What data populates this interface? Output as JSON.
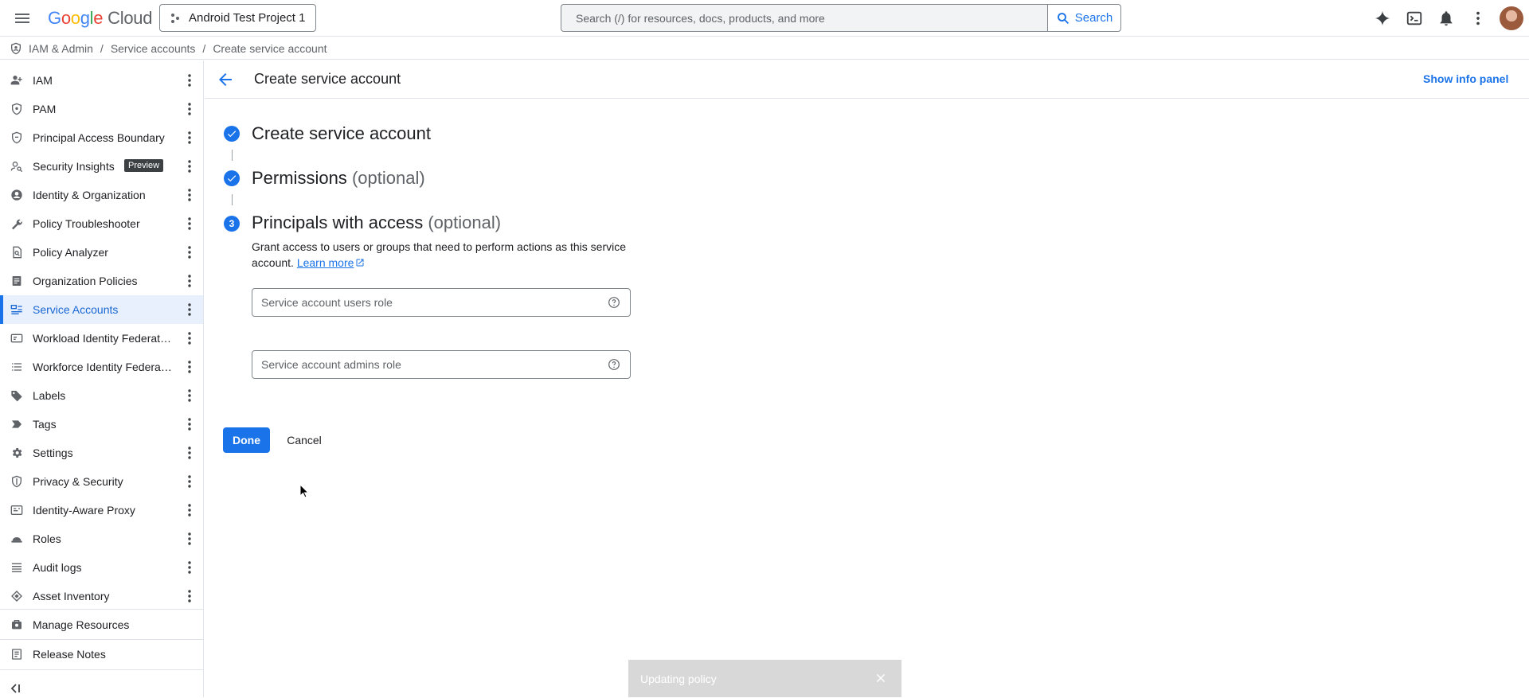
{
  "topbar": {
    "logo_google": "Google",
    "logo_cloud": "Cloud",
    "project_name": "Android Test Project 1",
    "search_placeholder": "Search (/) for resources, docs, products, and more",
    "search_button": "Search"
  },
  "breadcrumb": [
    "IAM & Admin",
    "Service accounts",
    "Create service account"
  ],
  "sidebar": {
    "items": [
      {
        "label": "IAM",
        "icon": "person-add-icon"
      },
      {
        "label": "PAM",
        "icon": "shield-icon"
      },
      {
        "label": "Principal Access Boundary",
        "icon": "boundary-shield-icon"
      },
      {
        "label": "Security Insights",
        "icon": "person-search-icon",
        "badge": "Preview"
      },
      {
        "label": "Identity & Organization",
        "icon": "account-circle-icon"
      },
      {
        "label": "Policy Troubleshooter",
        "icon": "wrench-icon"
      },
      {
        "label": "Policy Analyzer",
        "icon": "document-search-icon"
      },
      {
        "label": "Organization Policies",
        "icon": "list-document-icon"
      },
      {
        "label": "Service Accounts",
        "icon": "service-account-icon",
        "active": true
      },
      {
        "label": "Workload Identity Federation",
        "icon": "id-card-icon"
      },
      {
        "label": "Workforce Identity Federation",
        "icon": "list-icon"
      },
      {
        "label": "Labels",
        "icon": "label-icon"
      },
      {
        "label": "Tags",
        "icon": "tag-icon"
      },
      {
        "label": "Settings",
        "icon": "gear-icon"
      },
      {
        "label": "Privacy & Security",
        "icon": "privacy-shield-icon"
      },
      {
        "label": "Identity-Aware Proxy",
        "icon": "iap-icon"
      },
      {
        "label": "Roles",
        "icon": "roles-icon"
      },
      {
        "label": "Audit logs",
        "icon": "audit-list-icon"
      },
      {
        "label": "Asset Inventory",
        "icon": "asset-icon"
      }
    ],
    "footer_items": [
      {
        "label": "Manage Resources",
        "icon": "manage-resources-icon"
      },
      {
        "label": "Release Notes",
        "icon": "release-notes-icon"
      }
    ]
  },
  "page": {
    "title": "Create service account",
    "info_panel_link": "Show info panel"
  },
  "steps": [
    {
      "title": "Create service account",
      "optional": "",
      "state": "done"
    },
    {
      "title": "Permissions",
      "optional": "(optional)",
      "state": "done"
    },
    {
      "number": "3",
      "title": "Principals with access",
      "optional": "(optional)",
      "state": "current"
    }
  ],
  "step3": {
    "description": "Grant access to users or groups that need to perform actions as this service account.",
    "learn_more": "Learn more",
    "users_role_placeholder": "Service account users role",
    "admins_role_placeholder": "Service account admins role"
  },
  "actions": {
    "done": "Done",
    "cancel": "Cancel"
  },
  "toast": {
    "message": "Updating policy"
  },
  "colors": {
    "accent": "#1a73e8",
    "active_bg": "#e8f0fe"
  }
}
